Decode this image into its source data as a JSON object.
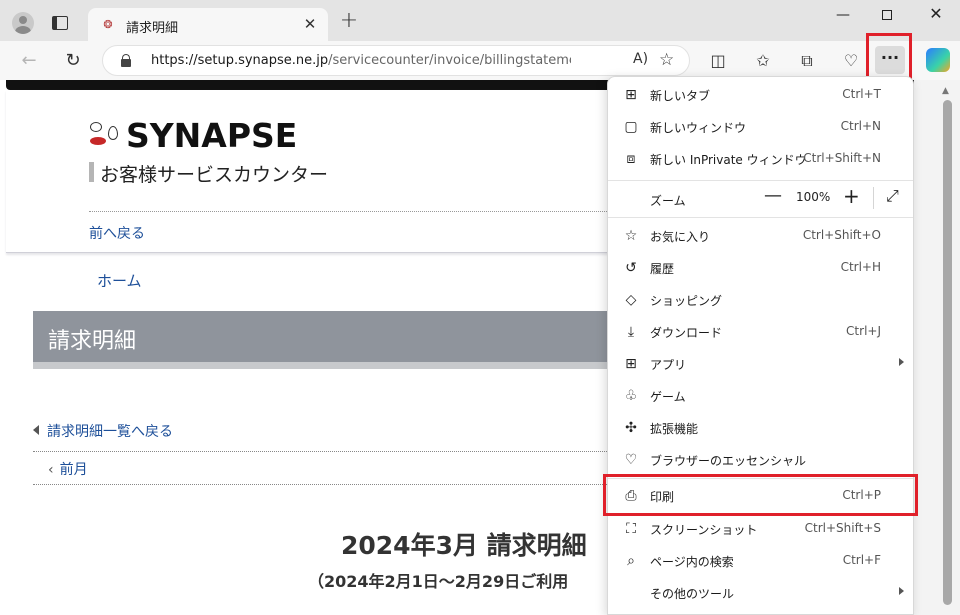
{
  "browser": {
    "tab_title": "請求明細",
    "url_main": "https://setup.synapse.ne.jp",
    "url_rest": "/servicecounter/invoice/billingstatement?billi...",
    "readaloud": "A)",
    "menu_button": "···"
  },
  "page": {
    "logo_text": "SYNAPSE",
    "logo_sub": "お客様サービスカウンター",
    "back_link": "前へ戻る",
    "home_link": "ホーム",
    "title": "請求明細",
    "list_back": "請求明細一覧へ戻る",
    "prev_month": "前月",
    "statement_title": "2024年3月 請求明細",
    "statement_sub": "（2024年2月1日～2月29日ご利用"
  },
  "menu": {
    "items": [
      {
        "label": "新しいタブ",
        "shortcut": "Ctrl+T"
      },
      {
        "label": "新しいウィンドウ",
        "shortcut": "Ctrl+N"
      },
      {
        "label": "新しい InPrivate ウィンドウ",
        "shortcut": "Ctrl+Shift+N"
      },
      {
        "label": "ズーム",
        "shortcut": ""
      },
      {
        "label": "お気に入り",
        "shortcut": "Ctrl+Shift+O"
      },
      {
        "label": "履歴",
        "shortcut": "Ctrl+H"
      },
      {
        "label": "ショッピング",
        "shortcut": ""
      },
      {
        "label": "ダウンロード",
        "shortcut": "Ctrl+J"
      },
      {
        "label": "アプリ",
        "shortcut": ""
      },
      {
        "label": "ゲーム",
        "shortcut": ""
      },
      {
        "label": "拡張機能",
        "shortcut": ""
      },
      {
        "label": "ブラウザーのエッセンシャル",
        "shortcut": ""
      },
      {
        "label": "印刷",
        "shortcut": "Ctrl+P"
      },
      {
        "label": "スクリーンショット",
        "shortcut": "Ctrl+Shift+S"
      },
      {
        "label": "ページ内の検索",
        "shortcut": "Ctrl+F"
      },
      {
        "label": "その他のツール",
        "shortcut": ""
      }
    ],
    "zoom_value": "100%"
  },
  "colors": {
    "highlight": "#e0202a",
    "link": "#1d4f99",
    "title_bar": "#8f949c"
  }
}
